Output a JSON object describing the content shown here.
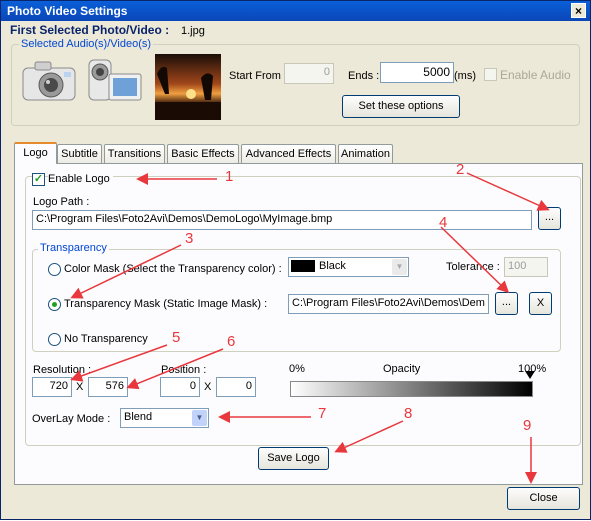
{
  "window": {
    "title": "Photo Video Settings",
    "close_glyph": "×"
  },
  "header": {
    "first_selected_label": "First Selected Photo/Video :",
    "first_selected_value": "1.jpg",
    "selected_audio_label": "Selected Audio(s)/Video(s)"
  },
  "timing": {
    "start_from_label": "Start From :",
    "start_from_value": "0",
    "ends_label": "Ends :",
    "ends_value": "5000",
    "ms_label": "(ms)",
    "enable_audio_label": "Enable Audio",
    "set_options_label": "Set these options"
  },
  "tabs": [
    {
      "label": "Logo"
    },
    {
      "label": "Subtitle"
    },
    {
      "label": "Transitions"
    },
    {
      "label": "Basic Effects"
    },
    {
      "label": "Advanced Effects"
    },
    {
      "label": "Animation"
    }
  ],
  "logo": {
    "enable_label": "Enable Logo",
    "enable_checked": true,
    "path_label": "Logo Path :",
    "path_value": "C:\\Program Files\\Foto2Avi\\Demos\\DemoLogo\\MyImage.bmp",
    "browse_label": "...",
    "transparency_group_label": "Transparency",
    "color_mask_label": "Color Mask (Select the Transparency color) :",
    "color_value": "Black",
    "color_swatch": "#000000",
    "tolerance_label": "Tolerance :",
    "tolerance_value": "100",
    "transparency_mask_label": "Transparency Mask (Static Image Mask) :",
    "mask_path_value": "C:\\Program Files\\Foto2Avi\\Demos\\Dem",
    "mask_browse_label": "...",
    "mask_clear_label": "X",
    "no_transparency_label": "No Transparency",
    "selected_transparency": "transparency-mask",
    "resolution_label": "Resolution :",
    "resolution_w": "720",
    "resolution_h": "576",
    "position_label": "Position :",
    "position_x": "0",
    "position_y": "0",
    "times_glyph": "X",
    "opacity_min_label": "0%",
    "opacity_label": "Opacity",
    "opacity_max_label": "100%",
    "opacity_value_percent": 100,
    "overlay_label": "OverLay Mode :",
    "overlay_value": "Blend",
    "save_label": "Save Logo"
  },
  "close_label": "Close",
  "annotations": [
    "1",
    "2",
    "3",
    "4",
    "5",
    "6",
    "7",
    "8",
    "9"
  ],
  "colors": {
    "annotation": "#e8383d",
    "titlebar": "#0a5fd8",
    "group_label": "#0046d5"
  }
}
